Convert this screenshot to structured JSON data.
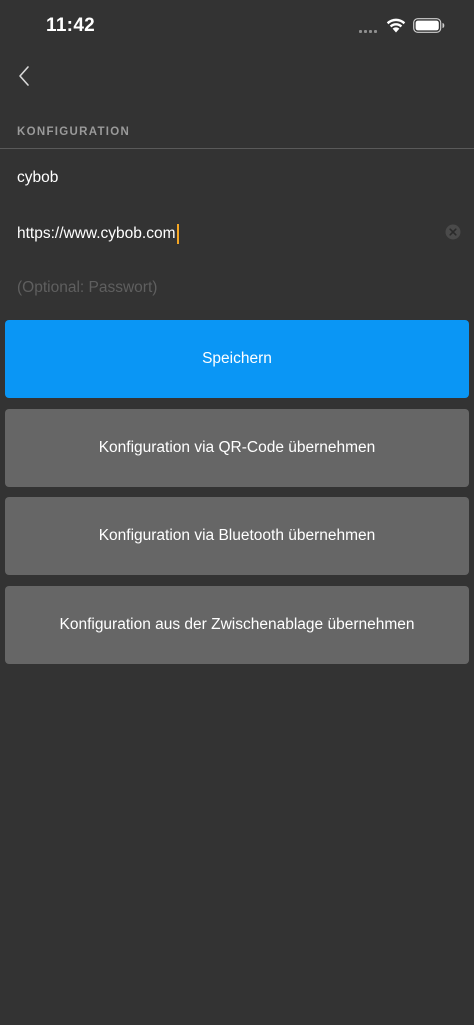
{
  "status_bar": {
    "time": "11:42"
  },
  "icons": {
    "back": "chevron-left-icon",
    "clear": "clear-circle-icon",
    "wifi": "wifi-icon",
    "battery": "battery-icon",
    "signal": "cellular-signal-icon"
  },
  "colors": {
    "background": "#333333",
    "primary": "#0a96f5",
    "secondary_button": "#666666",
    "cursor": "#f5a623"
  },
  "config": {
    "section_header": "KONFIGURATION",
    "username_value": "cybob",
    "url_value": "https://www.cybob.com",
    "password_placeholder": "(Optional: Passwort)"
  },
  "buttons": {
    "save": "Speichern",
    "qr": "Konfiguration via QR-Code übernehmen",
    "bluetooth": "Konfiguration via Bluetooth übernehmen",
    "clipboard": "Konfiguration aus der Zwischenablage übernehmen"
  }
}
